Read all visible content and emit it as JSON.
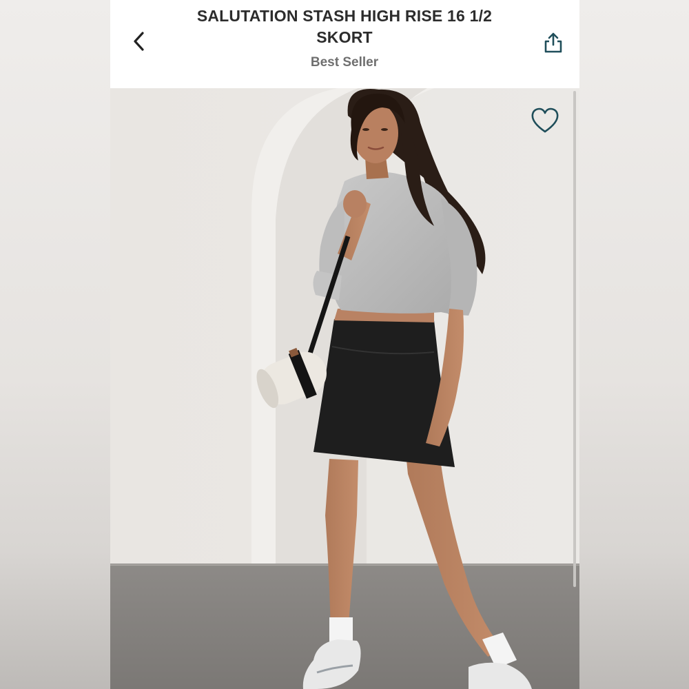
{
  "product": {
    "title_line1": "SALUTATION STASH HIGH RISE 16 1/2",
    "title_line2": "SKORT",
    "badge": "Best Seller"
  },
  "icons": {
    "back": "chevron-left-icon",
    "share": "share-icon",
    "favorite": "heart-outline-icon"
  },
  "colors": {
    "title": "#2c2c2c",
    "badge": "#6f6f6f",
    "accent": "#1f4e5a"
  }
}
